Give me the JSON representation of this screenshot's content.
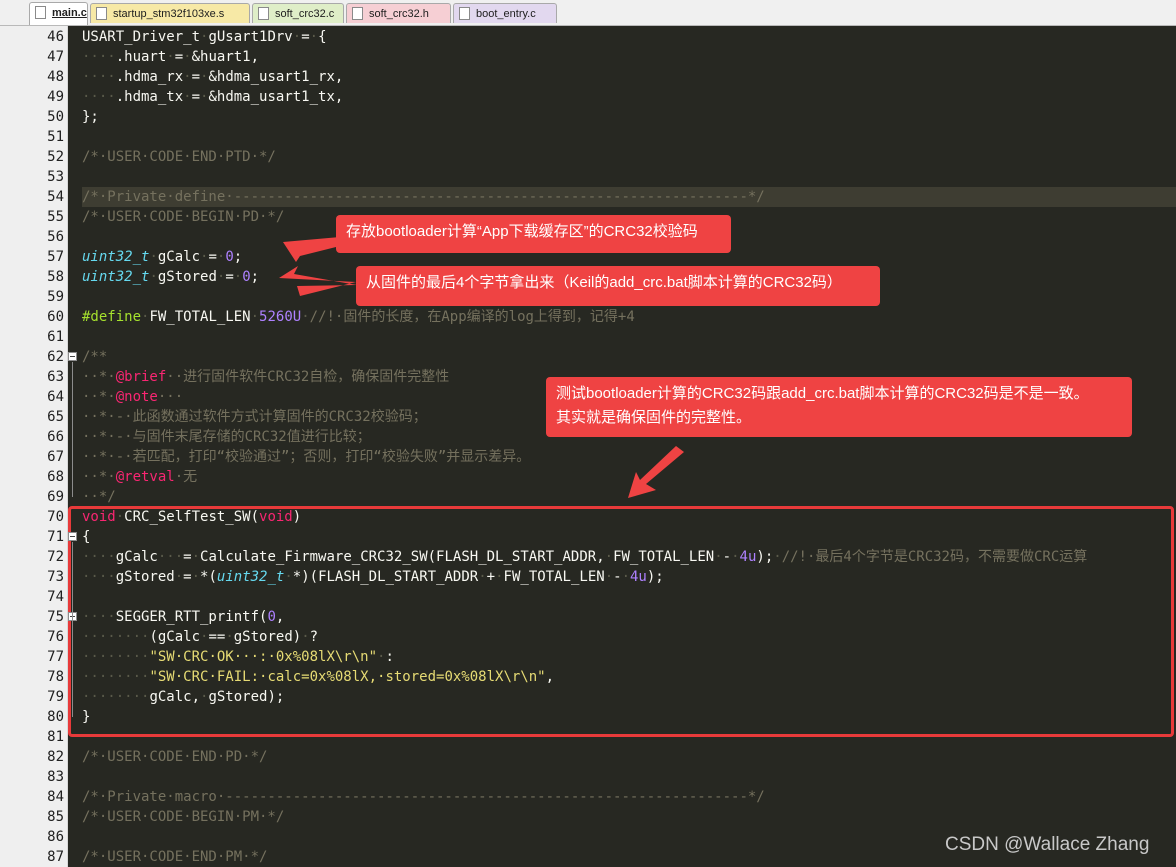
{
  "tabs": [
    {
      "label": "main.c",
      "active": true,
      "color": "#ffffff"
    },
    {
      "label": "startup_stm32f103xe.s",
      "active": false,
      "color": "#f7e9a6"
    },
    {
      "label": "soft_crc32.c",
      "active": false,
      "color": "#dfeec8"
    },
    {
      "label": "soft_crc32.h",
      "active": false,
      "color": "#f6cfd4"
    },
    {
      "label": "boot_entry.c",
      "active": false,
      "color": "#e2d8ef"
    }
  ],
  "line_numbers": [
    "46",
    "47",
    "48",
    "49",
    "50",
    "51",
    "52",
    "53",
    "54",
    "55",
    "56",
    "57",
    "58",
    "59",
    "60",
    "61",
    "62",
    "63",
    "64",
    "65",
    "66",
    "67",
    "68",
    "69",
    "70",
    "71",
    "72",
    "73",
    "74",
    "75",
    "76",
    "77",
    "78",
    "79",
    "80",
    "81",
    "82",
    "83",
    "84",
    "85",
    "86",
    "87"
  ],
  "highlighted_line": "54",
  "code_lines": [
    [
      [
        "t",
        "USART_Driver_t"
      ],
      [
        "s",
        "·"
      ],
      [
        "t",
        "gUsart1Drv"
      ],
      [
        "s",
        "·"
      ],
      [
        "t",
        "="
      ],
      [
        "s",
        "·"
      ],
      [
        "t",
        "{"
      ]
    ],
    [
      [
        "s",
        "····"
      ],
      [
        "t",
        ".huart"
      ],
      [
        "s",
        "·"
      ],
      [
        "t",
        "="
      ],
      [
        "s",
        "·"
      ],
      [
        "t",
        "&huart1,"
      ]
    ],
    [
      [
        "s",
        "····"
      ],
      [
        "t",
        ".hdma_rx"
      ],
      [
        "s",
        "·"
      ],
      [
        "t",
        "="
      ],
      [
        "s",
        "·"
      ],
      [
        "t",
        "&hdma_usart1_rx,"
      ]
    ],
    [
      [
        "s",
        "····"
      ],
      [
        "t",
        ".hdma_tx"
      ],
      [
        "s",
        "·"
      ],
      [
        "t",
        "="
      ],
      [
        "s",
        "·"
      ],
      [
        "t",
        "&hdma_usart1_tx,"
      ]
    ],
    [
      [
        "t",
        "};"
      ]
    ],
    [],
    [
      [
        "c",
        "/*·USER·CODE·END·PTD·*/"
      ]
    ],
    [],
    [
      [
        "c",
        "/*·Private·define·-------------------------------------------------------------*/"
      ]
    ],
    [
      [
        "c",
        "/*·USER·CODE·BEGIN·PD·*/"
      ]
    ],
    [],
    [
      [
        "y",
        "uint32_t"
      ],
      [
        "s",
        "·"
      ],
      [
        "t",
        "gCalc"
      ],
      [
        "s",
        "·"
      ],
      [
        "t",
        "="
      ],
      [
        "s",
        "·"
      ],
      [
        "n",
        "0"
      ],
      [
        "t",
        ";"
      ]
    ],
    [
      [
        "y",
        "uint32_t"
      ],
      [
        "s",
        "·"
      ],
      [
        "t",
        "gStored"
      ],
      [
        "s",
        "·"
      ],
      [
        "t",
        "="
      ],
      [
        "s",
        "·"
      ],
      [
        "n",
        "0"
      ],
      [
        "t",
        ";"
      ]
    ],
    [],
    [
      [
        "p",
        "#define"
      ],
      [
        "s",
        "·"
      ],
      [
        "t",
        "FW_TOTAL_LEN"
      ],
      [
        "s",
        "·"
      ],
      [
        "n",
        "5260U"
      ],
      [
        "s",
        "·"
      ],
      [
        "c",
        "//!·固件的长度，在App编译的log上得到，记得+4"
      ]
    ],
    [],
    [
      [
        "c",
        "/**"
      ]
    ],
    [
      [
        "c",
        "··*·"
      ],
      [
        "k",
        "@brief"
      ],
      [
        "c",
        "··进行固件软件CRC32自检，确保固件完整性"
      ]
    ],
    [
      [
        "c",
        "··*·"
      ],
      [
        "k",
        "@note"
      ],
      [
        "c",
        "···"
      ]
    ],
    [
      [
        "c",
        "··*·-·此函数通过软件方式计算固件的CRC32校验码；"
      ]
    ],
    [
      [
        "c",
        "··*·-·与固件末尾存储的CRC32值进行比较；"
      ]
    ],
    [
      [
        "c",
        "··*·-·若匹配，打印“校验通过”；否则，打印“校验失败”并显示差异。"
      ]
    ],
    [
      [
        "c",
        "··*·"
      ],
      [
        "k",
        "@retval"
      ],
      [
        "c",
        "·无"
      ]
    ],
    [
      [
        "c",
        "··*/"
      ]
    ],
    [
      [
        "k",
        "void"
      ],
      [
        "s",
        "·"
      ],
      [
        "t",
        "CRC_SelfTest_SW("
      ],
      [
        "k",
        "void"
      ],
      [
        "t",
        ")"
      ]
    ],
    [
      [
        "t",
        "{"
      ]
    ],
    [
      [
        "s",
        "····"
      ],
      [
        "t",
        "gCalc"
      ],
      [
        "s",
        "···"
      ],
      [
        "t",
        "="
      ],
      [
        "s",
        "·"
      ],
      [
        "t",
        "Calculate_Firmware_CRC32_SW(FLASH_DL_START_ADDR,"
      ],
      [
        "s",
        "·"
      ],
      [
        "t",
        "FW_TOTAL_LEN"
      ],
      [
        "s",
        "·"
      ],
      [
        "t",
        "-"
      ],
      [
        "s",
        "·"
      ],
      [
        "n",
        "4u"
      ],
      [
        "t",
        ");"
      ],
      [
        "s",
        "·"
      ],
      [
        "c",
        "//!·最后4个字节是CRC32码，不需要做CRC运算"
      ]
    ],
    [
      [
        "s",
        "····"
      ],
      [
        "t",
        "gStored"
      ],
      [
        "s",
        "·"
      ],
      [
        "t",
        "="
      ],
      [
        "s",
        "·"
      ],
      [
        "t",
        "*("
      ],
      [
        "y",
        "uint32_t"
      ],
      [
        "s",
        "·"
      ],
      [
        "t",
        "*)(FLASH_DL_START_ADDR"
      ],
      [
        "s",
        "·"
      ],
      [
        "t",
        "+"
      ],
      [
        "s",
        "·"
      ],
      [
        "t",
        "FW_TOTAL_LEN"
      ],
      [
        "s",
        "·"
      ],
      [
        "t",
        "-"
      ],
      [
        "s",
        "·"
      ],
      [
        "n",
        "4u"
      ],
      [
        "t",
        ");"
      ]
    ],
    [],
    [
      [
        "s",
        "····"
      ],
      [
        "t",
        "SEGGER_RTT_printf("
      ],
      [
        "n",
        "0"
      ],
      [
        "t",
        ","
      ]
    ],
    [
      [
        "s",
        "········"
      ],
      [
        "t",
        "(gCalc"
      ],
      [
        "s",
        "·"
      ],
      [
        "t",
        "=="
      ],
      [
        "s",
        "·"
      ],
      [
        "t",
        "gStored)"
      ],
      [
        "s",
        "·"
      ],
      [
        "t",
        "?"
      ]
    ],
    [
      [
        "s",
        "········"
      ],
      [
        "q",
        "\"SW·CRC·OK···:·0x%08lX\\r\\n\""
      ],
      [
        "s",
        "·"
      ],
      [
        "t",
        ":"
      ]
    ],
    [
      [
        "s",
        "········"
      ],
      [
        "q",
        "\"SW·CRC·FAIL:·calc=0x%08lX,·stored=0x%08lX\\r\\n\""
      ],
      [
        "t",
        ","
      ]
    ],
    [
      [
        "s",
        "········"
      ],
      [
        "t",
        "gCalc,"
      ],
      [
        "s",
        "·"
      ],
      [
        "t",
        "gStored);"
      ]
    ],
    [
      [
        "t",
        "}"
      ]
    ],
    [],
    [
      [
        "c",
        "/*·USER·CODE·END·PD·*/"
      ]
    ],
    [],
    [
      [
        "c",
        "/*·Private·macro·--------------------------------------------------------------*/"
      ]
    ],
    [
      [
        "c",
        "/*·USER·CODE·BEGIN·PM·*/"
      ]
    ],
    [],
    [
      [
        "c",
        "/*·USER·CODE·END·PM·*/"
      ]
    ]
  ],
  "annotations": {
    "gcalc_note": "存放bootloader计算“App下载缓存区”的CRC32校验码",
    "gstored_note": "从固件的最后4个字节拿出来（Keil的add_crc.bat脚本计算的CRC32码）",
    "selftest_note_line1": "测试bootloader计算的CRC32码跟add_crc.bat脚本计算的CRC32码是不是一致。",
    "selftest_note_line2": "其实就是确保固件的完整性。"
  },
  "watermark": "CSDN @Wallace Zhang",
  "colors": {
    "editor_bg": "#272822",
    "annotation_red": "#ef4343",
    "highlight_box": "#e83a3a"
  }
}
